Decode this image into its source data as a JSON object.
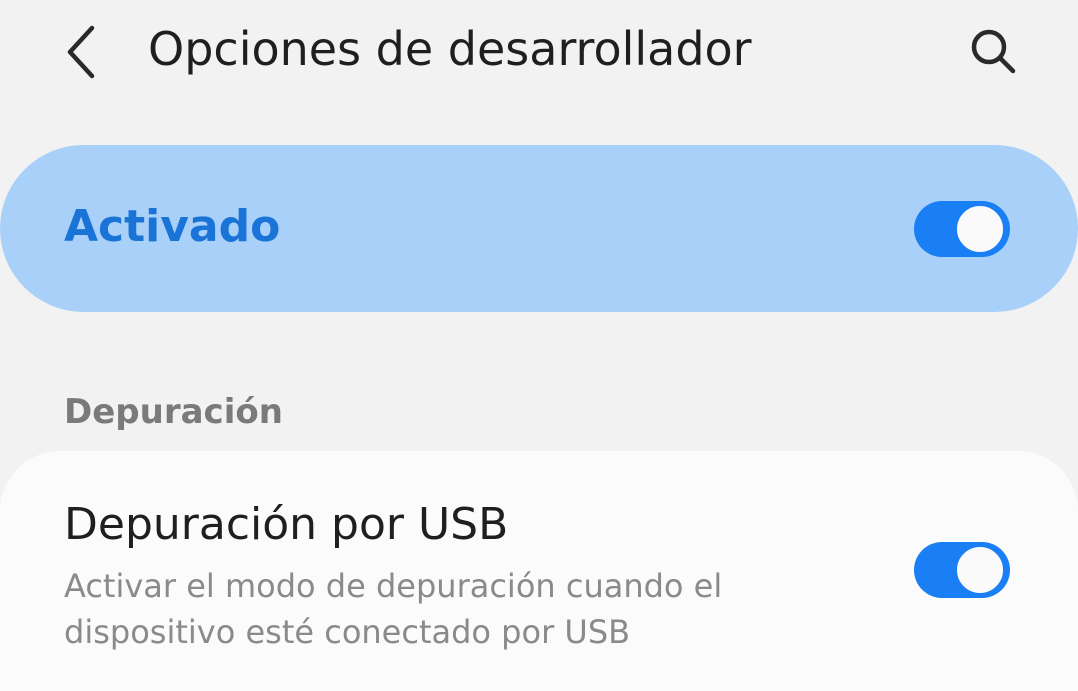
{
  "header": {
    "title": "Opciones de desarrollador",
    "back_icon": "chevron-left-icon",
    "search_icon": "search-icon"
  },
  "master_switch": {
    "label": "Activado",
    "state": "on",
    "accent_color": "#1a73d6",
    "background_color": "#a9d0f8"
  },
  "section": {
    "header": "Depuración"
  },
  "items": [
    {
      "title": "Depuración por USB",
      "description": "Activar el modo de depuración cuando el dispositivo esté conectado por USB",
      "state": "on"
    }
  ],
  "colors": {
    "toggle_on": "#1a7ff5",
    "page_background": "#f2f2f2"
  }
}
